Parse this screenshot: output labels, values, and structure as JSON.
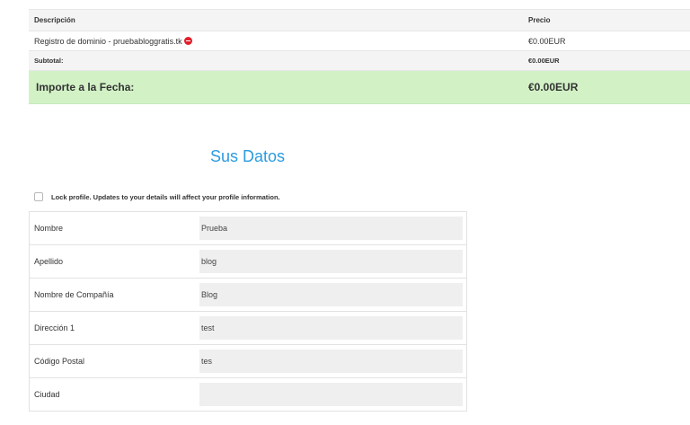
{
  "order": {
    "header": {
      "description": "Descripción",
      "price": "Precio"
    },
    "item": {
      "description": "Registro de dominio - pruebabloggratis.tk",
      "price": "€0.00EUR"
    },
    "subtotal": {
      "label": "Subtotal:",
      "value": "€0.00EUR"
    },
    "total": {
      "label": "Importe a la Fecha:",
      "value": "€0.00EUR"
    }
  },
  "section_title": "Sus Datos",
  "lock_profile": {
    "label": "Lock profile. Updates to your details will affect your profile information.",
    "checked": false
  },
  "form": {
    "fields": [
      {
        "label": "Nombre",
        "value": "Prueba"
      },
      {
        "label": "Apellido",
        "value": "blog"
      },
      {
        "label": "Nombre de Compañía",
        "value": "Blog"
      },
      {
        "label": "Dirección 1",
        "value": "test"
      },
      {
        "label": "Código Postal",
        "value": "tes"
      },
      {
        "label": "Ciudad",
        "value": ""
      }
    ]
  },
  "colors": {
    "accent": "#2c9be0",
    "total_bg": "#d2f2c6",
    "remove_icon": "#e0202b"
  },
  "icons": {
    "remove": "remove-icon"
  }
}
